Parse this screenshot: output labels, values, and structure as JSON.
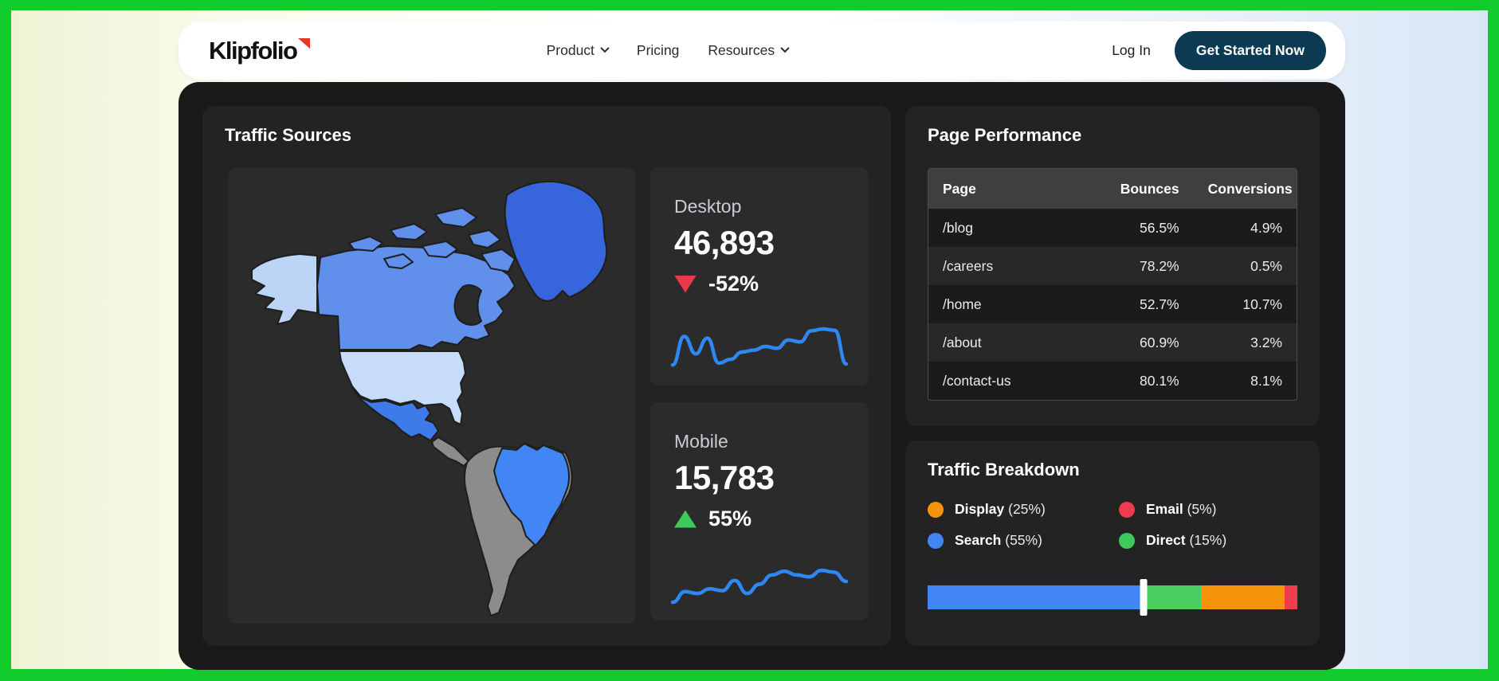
{
  "colors": {
    "frame_green": "#12cb2d",
    "cta_bg": "#0c3a52",
    "sparkline_blue": "#2f87f1",
    "delta_down": "#e8394a",
    "delta_up": "#3dc95b"
  },
  "header": {
    "logo_text": "Klipfolio",
    "nav": [
      {
        "label": "Product",
        "has_dropdown": true
      },
      {
        "label": "Pricing",
        "has_dropdown": false
      },
      {
        "label": "Resources",
        "has_dropdown": true
      }
    ],
    "login_label": "Log In",
    "cta_label": "Get Started Now"
  },
  "dashboard": {
    "traffic_sources": {
      "title": "Traffic Sources",
      "map_colors": {
        "alaska": "#bcd4f6",
        "canada": "#6090ec",
        "greenland": "#3766dc",
        "usa": "#c7dcf9",
        "mexico": "#3e7ae9",
        "central_america": "#8c8c8c",
        "south_america": "#8c8c8c",
        "brazil": "#4285f4"
      },
      "stats": [
        {
          "label": "Desktop",
          "value": "46,893",
          "delta": "-52%",
          "direction": "down",
          "trend": [
            10,
            72,
            34,
            68,
            14,
            22,
            38,
            42,
            50,
            46,
            64,
            60,
            84,
            88,
            85,
            12
          ]
        },
        {
          "label": "Mobile",
          "value": "15,783",
          "delta": "55%",
          "direction": "up",
          "trend": [
            5,
            28,
            24,
            34,
            30,
            52,
            24,
            44,
            64,
            72,
            64,
            60,
            74,
            70,
            50
          ]
        }
      ]
    },
    "page_performance": {
      "title": "Page Performance",
      "table": {
        "columns": [
          "Page",
          "Bounces",
          "Conversions"
        ],
        "rows": [
          [
            "/blog",
            "56.5%",
            "4.9%"
          ],
          [
            "/careers",
            "78.2%",
            "0.5%"
          ],
          [
            "/home",
            "52.7%",
            "10.7%"
          ],
          [
            "/about",
            "60.9%",
            "3.2%"
          ],
          [
            "/contact-us",
            "80.1%",
            "8.1%"
          ]
        ]
      }
    },
    "traffic_breakdown": {
      "title": "Traffic Breakdown",
      "legend": [
        {
          "label": "Display",
          "percent": "(25%)",
          "color": "#f5930a"
        },
        {
          "label": "Email",
          "percent": "(5%)",
          "color": "#ee3b4d"
        },
        {
          "label": "Search",
          "percent": "(55%)",
          "color": "#4285f4"
        },
        {
          "label": "Direct",
          "percent": "(15%)",
          "color": "#3dc95b"
        }
      ],
      "bar": {
        "segments": [
          {
            "name": "Search",
            "color": "#4285f4",
            "width_percent": 58.5
          },
          {
            "name": "Direct",
            "color": "#49ce62",
            "width_percent": 15.5
          },
          {
            "name": "Display",
            "color": "#f5930a",
            "width_percent": 22.6
          },
          {
            "name": "Email",
            "color": "#ee3b4d",
            "width_percent": 3.4
          }
        ],
        "marker_position_percent": 58.5
      }
    }
  }
}
